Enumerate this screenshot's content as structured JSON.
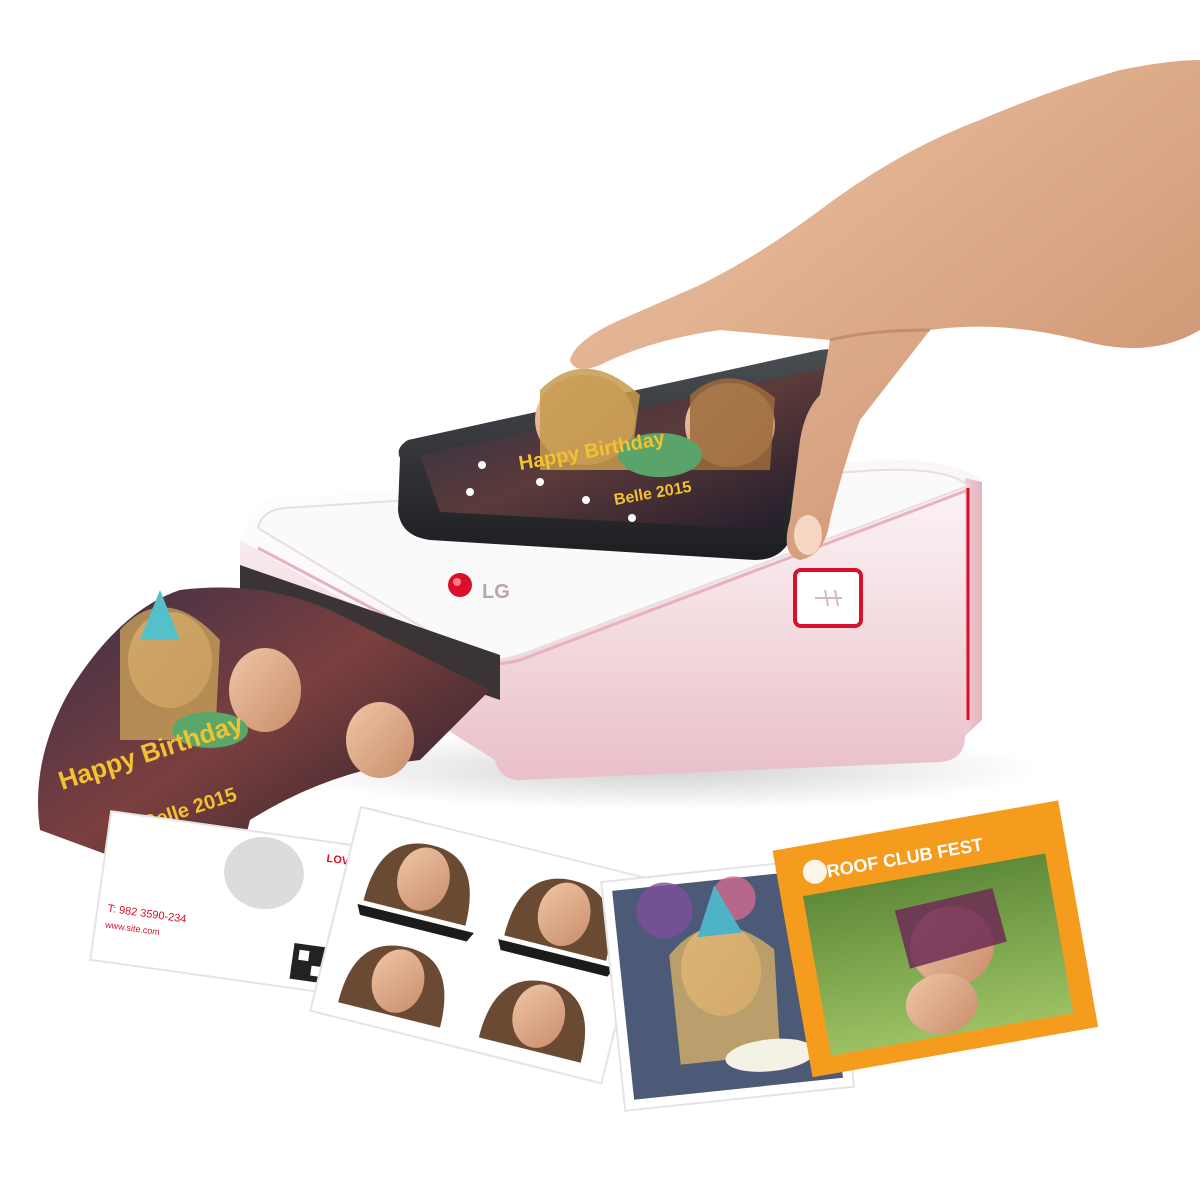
{
  "printer": {
    "brand_logo": "LG",
    "body_color": "#f3dbe0",
    "accent_color": "#d8102c"
  },
  "phone": {
    "screen_text_line1": "Happy Birthday",
    "screen_text_line2": "Belle 2015"
  },
  "printed_photo": {
    "caption_line1": "Happy Birthday",
    "caption_line2": "Belle 2015"
  },
  "cards": {
    "business_card": {
      "tag": "LOVE",
      "phone_line": "T: 982 3590-234",
      "url_line": "www.site.com"
    },
    "orange_card": {
      "header": "ROOF CLUB FEST"
    }
  },
  "icons": [
    "hand",
    "usb-port-icon",
    "power-button",
    "qr-code-icon"
  ]
}
